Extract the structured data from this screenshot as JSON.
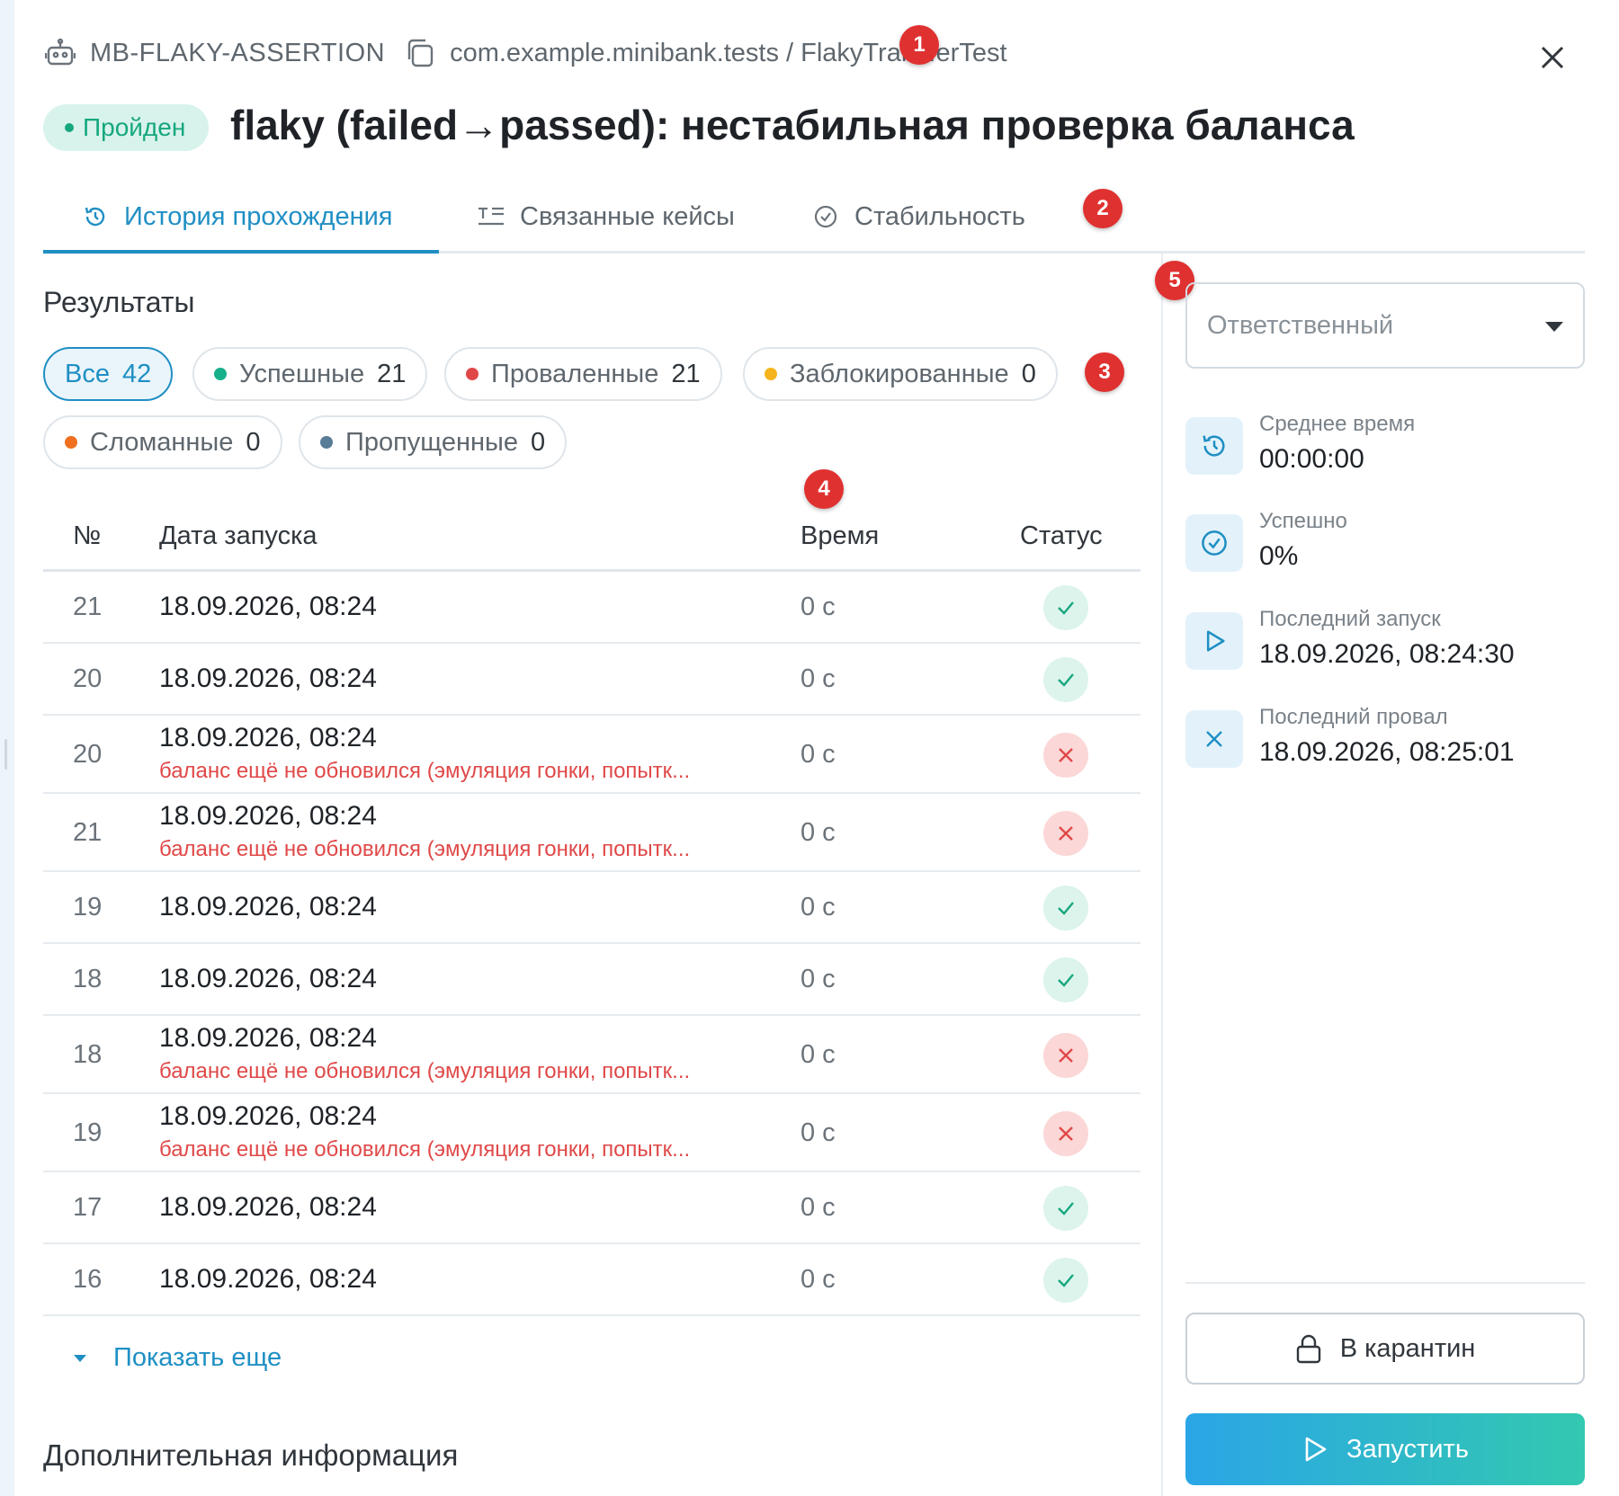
{
  "header": {
    "test_key": "MB-FLAKY-ASSERTION",
    "path": "com.example.minibank.tests / FlakyTransferTest",
    "status": "Пройден",
    "title": "flaky (failed→passed): нестабильная проверка баланса"
  },
  "markers": [
    "1",
    "2",
    "3",
    "4",
    "5"
  ],
  "tabs": [
    {
      "label": "История прохождения",
      "icon": "history-icon",
      "active": true
    },
    {
      "label": "Связанные кейсы",
      "icon": "linked-cases-icon",
      "active": false
    },
    {
      "label": "Стабильность",
      "icon": "check-circle-icon",
      "active": false
    }
  ],
  "results": {
    "title": "Результаты",
    "filters": [
      {
        "label": "Все",
        "count": "42",
        "color": null,
        "active": true
      },
      {
        "label": "Успешные",
        "count": "21",
        "color": "#16b08a",
        "active": false
      },
      {
        "label": "Проваленные",
        "count": "21",
        "color": "#e04848",
        "active": false
      },
      {
        "label": "Заблокированные",
        "count": "0",
        "color": "#f5b41b",
        "active": false
      },
      {
        "label": "Сломанные",
        "count": "0",
        "color": "#f07020",
        "active": false
      },
      {
        "label": "Пропущенные",
        "count": "0",
        "color": "#5a7d97",
        "active": false
      }
    ]
  },
  "table": {
    "columns": [
      "№",
      "Дата запуска",
      "Время",
      "Статус"
    ],
    "rows": [
      {
        "num": "21",
        "date": "18.09.2026, 08:24",
        "error": "",
        "time": "0 с",
        "status": "passed"
      },
      {
        "num": "20",
        "date": "18.09.2026, 08:24",
        "error": "",
        "time": "0 с",
        "status": "passed"
      },
      {
        "num": "20",
        "date": "18.09.2026, 08:24",
        "error": "баланс ещё не обновился (эмуляция гонки, попытк...",
        "time": "0 с",
        "status": "failed"
      },
      {
        "num": "21",
        "date": "18.09.2026, 08:24",
        "error": "баланс ещё не обновился (эмуляция гонки, попытк...",
        "time": "0 с",
        "status": "failed"
      },
      {
        "num": "19",
        "date": "18.09.2026, 08:24",
        "error": "",
        "time": "0 с",
        "status": "passed"
      },
      {
        "num": "18",
        "date": "18.09.2026, 08:24",
        "error": "",
        "time": "0 с",
        "status": "passed"
      },
      {
        "num": "18",
        "date": "18.09.2026, 08:24",
        "error": "баланс ещё не обновился (эмуляция гонки, попытк...",
        "time": "0 с",
        "status": "failed"
      },
      {
        "num": "19",
        "date": "18.09.2026, 08:24",
        "error": "баланс ещё не обновился (эмуляция гонки, попытк...",
        "time": "0 с",
        "status": "failed"
      },
      {
        "num": "17",
        "date": "18.09.2026, 08:24",
        "error": "",
        "time": "0 с",
        "status": "passed"
      },
      {
        "num": "16",
        "date": "18.09.2026, 08:24",
        "error": "",
        "time": "0 с",
        "status": "passed"
      }
    ],
    "show_more": "Показать еще"
  },
  "extra": {
    "title": "Дополнительная информация"
  },
  "sidebar": {
    "assignee_placeholder": "Ответственный",
    "stats": [
      {
        "label": "Среднее время",
        "value": "00:00:00",
        "icon": "history-icon"
      },
      {
        "label": "Успешно",
        "value": "0%",
        "icon": "check-circle-icon"
      },
      {
        "label": "Последний запуск",
        "value": "18.09.2026, 08:24:30",
        "icon": "play-icon"
      },
      {
        "label": "Последний провал",
        "value": "18.09.2026, 08:25:01",
        "icon": "x-icon"
      }
    ],
    "quarantine_label": "В карантин",
    "run_label": "Запустить"
  },
  "colors": {
    "accent": "#1f8fc4",
    "passed": "#16a77e",
    "failed": "#e04848",
    "run_gradient_start": "#2aa6e6",
    "run_gradient_end": "#33c8b0"
  }
}
